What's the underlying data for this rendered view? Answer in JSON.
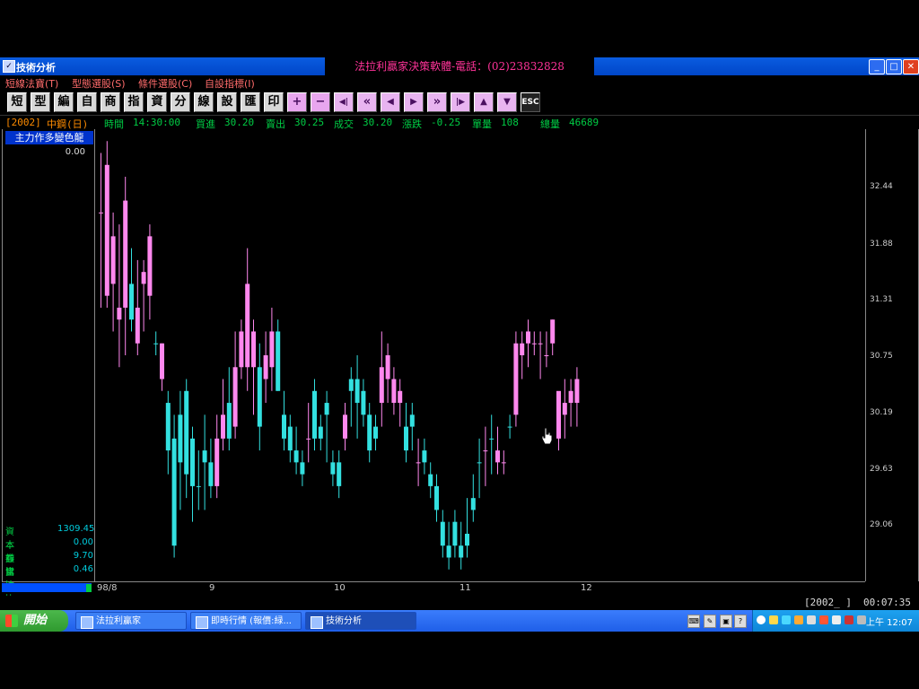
{
  "window": {
    "title": "技術分析",
    "banner": "法拉利贏家決策軟體-電話：(02)23832828",
    "controls": [
      "minimize",
      "maximize",
      "close"
    ]
  },
  "menu": {
    "items": [
      "短線法寶(T)",
      "型態選股(S)",
      "條件選股(C)",
      "自設指標(I)"
    ]
  },
  "toolbar": {
    "buttons": [
      "短",
      "型",
      "編",
      "自",
      "商",
      "指",
      "資",
      "分",
      "線",
      "設",
      "匯",
      "印",
      "+",
      "−",
      "◀|",
      "«",
      "◀",
      "▶",
      "»",
      "|▶",
      "▲",
      "▼",
      "ESC"
    ]
  },
  "quote": {
    "symbol": "[2002]",
    "name": "中鋼(日)",
    "time_label": "時間",
    "time": "14:30:00",
    "bid_label": "買進",
    "bid": "30.20",
    "ask_label": "賣出",
    "ask": "30.25",
    "trade_label": "成交",
    "trade": "30.20",
    "change_label": "漲跌",
    "change": "-0.25",
    "unit_vol_label": "單量",
    "unit_vol": "108",
    "total_vol_label": "總量",
    "total_vol": "46689"
  },
  "indicator": {
    "title": "主力作多變色龍",
    "value": "0.00"
  },
  "stats": [
    {
      "label": "資本額",
      "value": "1309.45"
    },
    {
      "label": "本益比",
      "value": "0.00"
    },
    {
      "label": "券資比",
      "value": "9.70"
    },
    {
      "label": "當沖比",
      "value": "0.46"
    }
  ],
  "status": {
    "symbol": "[2002_ ]",
    "clock": "00:07:35"
  },
  "taskbar": {
    "start": "開始",
    "tasks": [
      "法拉利贏家",
      "即時行情 (報價:緑...",
      "技術分析"
    ],
    "time": "上午 12:07"
  },
  "chart_data": {
    "type": "candlestick",
    "y_ticks": [
      "32.44",
      "31.88",
      "31.31",
      "30.75",
      "30.19",
      "29.63",
      "29.06"
    ],
    "x_ticks": [
      "98/8",
      "9",
      "10",
      "11",
      "12"
    ],
    "colors": {
      "up": "#ff88ee",
      "down": "#33e0e0",
      "axis": "#888888",
      "text": "#cccccc"
    },
    "ylim": [
      28.8,
      32.6
    ],
    "candles": [
      {
        "o": 31.9,
        "h": 32.4,
        "l": 31.1,
        "c": 31.9,
        "up": true
      },
      {
        "o": 31.2,
        "h": 32.5,
        "l": 31.1,
        "c": 32.3,
        "up": true
      },
      {
        "o": 31.3,
        "h": 31.9,
        "l": 30.9,
        "c": 31.7,
        "up": true
      },
      {
        "o": 31.1,
        "h": 31.8,
        "l": 30.6,
        "c": 31.0,
        "up": true
      },
      {
        "o": 31.1,
        "h": 32.2,
        "l": 30.7,
        "c": 32.0,
        "up": true
      },
      {
        "o": 31.3,
        "h": 31.6,
        "l": 30.9,
        "c": 31.0,
        "up": false
      },
      {
        "o": 30.8,
        "h": 31.5,
        "l": 30.7,
        "c": 31.1,
        "up": true
      },
      {
        "o": 31.3,
        "h": 31.5,
        "l": 30.9,
        "c": 31.4,
        "up": true
      },
      {
        "o": 31.2,
        "h": 31.8,
        "l": 31.0,
        "c": 31.7,
        "up": true
      },
      {
        "o": 30.8,
        "h": 30.9,
        "l": 30.7,
        "c": 30.8,
        "up": false
      },
      {
        "o": 30.5,
        "h": 30.8,
        "l": 30.4,
        "c": 30.8,
        "up": true
      },
      {
        "o": 30.3,
        "h": 30.4,
        "l": 29.7,
        "c": 29.9,
        "up": false
      },
      {
        "o": 30.0,
        "h": 30.2,
        "l": 29.0,
        "c": 29.1,
        "up": false
      },
      {
        "o": 30.2,
        "h": 30.4,
        "l": 29.4,
        "c": 29.8,
        "up": false
      },
      {
        "o": 30.4,
        "h": 30.5,
        "l": 29.5,
        "c": 29.7,
        "up": false
      },
      {
        "o": 30.0,
        "h": 30.1,
        "l": 29.3,
        "c": 29.6,
        "up": false
      },
      {
        "o": 29.6,
        "h": 29.9,
        "l": 29.4,
        "c": 29.6,
        "up": false
      },
      {
        "o": 29.9,
        "h": 30.2,
        "l": 29.4,
        "c": 29.8,
        "up": false
      },
      {
        "o": 29.8,
        "h": 30.0,
        "l": 29.5,
        "c": 29.6,
        "up": false
      },
      {
        "o": 29.6,
        "h": 30.2,
        "l": 29.5,
        "c": 30.0,
        "up": true
      },
      {
        "o": 30.0,
        "h": 30.5,
        "l": 29.9,
        "c": 30.2,
        "up": true
      },
      {
        "o": 30.3,
        "h": 30.6,
        "l": 29.9,
        "c": 30.0,
        "up": false
      },
      {
        "o": 30.1,
        "h": 30.9,
        "l": 30.0,
        "c": 30.6,
        "up": true
      },
      {
        "o": 30.6,
        "h": 31.0,
        "l": 30.5,
        "c": 30.9,
        "up": true
      },
      {
        "o": 30.6,
        "h": 31.6,
        "l": 30.4,
        "c": 31.3,
        "up": true
      },
      {
        "o": 30.6,
        "h": 31.0,
        "l": 30.2,
        "c": 30.9,
        "up": true
      },
      {
        "o": 30.6,
        "h": 30.8,
        "l": 29.9,
        "c": 30.1,
        "up": false
      },
      {
        "o": 30.5,
        "h": 30.9,
        "l": 30.3,
        "c": 30.7,
        "up": true
      },
      {
        "o": 30.6,
        "h": 31.1,
        "l": 30.4,
        "c": 30.9,
        "up": true
      },
      {
        "o": 30.9,
        "h": 31.0,
        "l": 30.4,
        "c": 30.4,
        "up": false
      },
      {
        "o": 30.2,
        "h": 30.4,
        "l": 29.9,
        "c": 30.0,
        "up": false
      },
      {
        "o": 30.1,
        "h": 30.2,
        "l": 29.8,
        "c": 29.9,
        "up": false
      },
      {
        "o": 29.9,
        "h": 30.1,
        "l": 29.7,
        "c": 29.8,
        "up": false
      },
      {
        "o": 29.8,
        "h": 29.9,
        "l": 29.6,
        "c": 29.7,
        "up": false
      },
      {
        "o": 30.0,
        "h": 30.3,
        "l": 29.8,
        "c": 30.0,
        "up": true
      },
      {
        "o": 30.4,
        "h": 30.5,
        "l": 29.9,
        "c": 30.0,
        "up": false
      },
      {
        "o": 30.1,
        "h": 30.2,
        "l": 29.9,
        "c": 30.0,
        "up": false
      },
      {
        "o": 30.3,
        "h": 30.4,
        "l": 29.8,
        "c": 30.2,
        "up": false
      },
      {
        "o": 29.8,
        "h": 29.9,
        "l": 29.6,
        "c": 29.7,
        "up": false
      },
      {
        "o": 29.8,
        "h": 29.9,
        "l": 29.5,
        "c": 29.6,
        "up": false
      },
      {
        "o": 30.0,
        "h": 30.3,
        "l": 29.9,
        "c": 30.2,
        "up": true
      },
      {
        "o": 30.4,
        "h": 30.6,
        "l": 30.1,
        "c": 30.5,
        "up": false
      },
      {
        "o": 30.3,
        "h": 30.7,
        "l": 30.0,
        "c": 30.5,
        "up": false
      },
      {
        "o": 30.4,
        "h": 30.5,
        "l": 30.1,
        "c": 30.2,
        "up": false
      },
      {
        "o": 30.2,
        "h": 30.3,
        "l": 29.8,
        "c": 29.9,
        "up": false
      },
      {
        "o": 30.0,
        "h": 30.2,
        "l": 29.9,
        "c": 30.1,
        "up": false
      },
      {
        "o": 30.3,
        "h": 30.9,
        "l": 30.1,
        "c": 30.6,
        "up": true
      },
      {
        "o": 30.5,
        "h": 30.8,
        "l": 30.3,
        "c": 30.7,
        "up": true
      },
      {
        "o": 30.3,
        "h": 30.6,
        "l": 30.2,
        "c": 30.5,
        "up": true
      },
      {
        "o": 30.4,
        "h": 30.5,
        "l": 30.1,
        "c": 30.3,
        "up": true
      },
      {
        "o": 30.1,
        "h": 30.3,
        "l": 29.8,
        "c": 29.9,
        "up": false
      },
      {
        "o": 30.1,
        "h": 30.3,
        "l": 29.9,
        "c": 30.2,
        "up": false
      },
      {
        "o": 29.8,
        "h": 30.0,
        "l": 29.6,
        "c": 29.8,
        "up": true
      },
      {
        "o": 29.9,
        "h": 30.0,
        "l": 29.7,
        "c": 29.8,
        "up": false
      },
      {
        "o": 29.7,
        "h": 29.8,
        "l": 29.5,
        "c": 29.6,
        "up": false
      },
      {
        "o": 29.6,
        "h": 29.7,
        "l": 29.3,
        "c": 29.4,
        "up": false
      },
      {
        "o": 29.3,
        "h": 29.4,
        "l": 29.0,
        "c": 29.1,
        "up": false
      },
      {
        "o": 29.1,
        "h": 29.3,
        "l": 28.9,
        "c": 29.0,
        "up": false
      },
      {
        "o": 29.3,
        "h": 29.4,
        "l": 29.0,
        "c": 29.1,
        "up": false
      },
      {
        "o": 29.1,
        "h": 29.3,
        "l": 28.9,
        "c": 29.0,
        "up": false
      },
      {
        "o": 29.2,
        "h": 29.5,
        "l": 29.0,
        "c": 29.1,
        "up": false
      },
      {
        "o": 29.5,
        "h": 29.7,
        "l": 29.3,
        "c": 29.4,
        "up": false
      },
      {
        "o": 29.8,
        "h": 30.0,
        "l": 29.5,
        "c": 29.8,
        "up": false
      },
      {
        "o": 29.9,
        "h": 30.1,
        "l": 29.6,
        "c": 29.9,
        "up": true
      },
      {
        "o": 30.0,
        "h": 30.2,
        "l": 29.7,
        "c": 30.0,
        "up": false
      },
      {
        "o": 29.9,
        "h": 30.1,
        "l": 29.7,
        "c": 29.8,
        "up": true
      },
      {
        "o": 29.8,
        "h": 29.9,
        "l": 29.7,
        "c": 29.8,
        "up": true
      },
      {
        "o": 30.1,
        "h": 30.2,
        "l": 30.0,
        "c": 30.1,
        "up": false
      },
      {
        "o": 30.2,
        "h": 30.9,
        "l": 30.1,
        "c": 30.8,
        "up": true
      },
      {
        "o": 30.7,
        "h": 30.9,
        "l": 30.5,
        "c": 30.8,
        "up": true
      },
      {
        "o": 30.8,
        "h": 31.0,
        "l": 30.6,
        "c": 30.9,
        "up": true
      },
      {
        "o": 30.8,
        "h": 30.9,
        "l": 30.7,
        "c": 30.8,
        "up": true
      },
      {
        "o": 30.8,
        "h": 30.9,
        "l": 30.5,
        "c": 30.8,
        "up": true
      },
      {
        "o": 30.7,
        "h": 30.9,
        "l": 30.6,
        "c": 30.7,
        "up": true
      },
      {
        "o": 30.8,
        "h": 31.0,
        "l": 30.7,
        "c": 31.0,
        "up": true
      },
      {
        "o": 30.0,
        "h": 30.3,
        "l": 29.9,
        "c": 30.4,
        "up": true
      },
      {
        "o": 30.2,
        "h": 30.5,
        "l": 30.0,
        "c": 30.3,
        "up": true
      },
      {
        "o": 30.3,
        "h": 30.5,
        "l": 30.1,
        "c": 30.4,
        "up": true
      },
      {
        "o": 30.3,
        "h": 30.6,
        "l": 30.1,
        "c": 30.5,
        "up": true
      }
    ]
  }
}
